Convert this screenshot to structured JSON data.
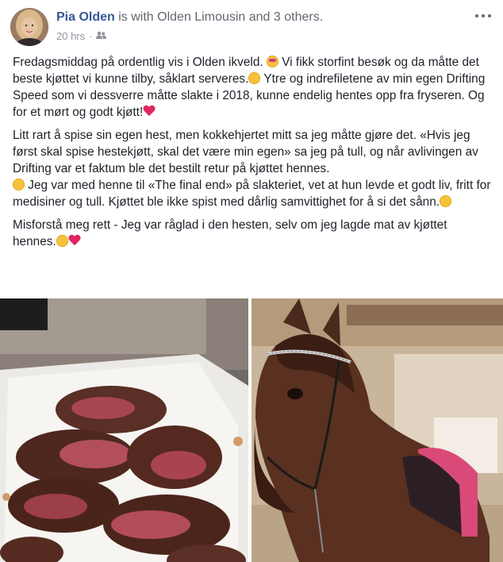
{
  "post": {
    "author": "Pia Olden",
    "with_text": " is with ",
    "tagged_page": "Olden Limousin",
    "and_text": " and ",
    "others": "3 others.",
    "time": "20 hrs",
    "separator": "·",
    "audience_icon": "friends-icon",
    "more_icon": "more-options-icon"
  },
  "body": {
    "p1a": "Fredagsmiddag på ordentlig vis i Olden ikveld.",
    "p1b": " Vi fikk storfint besøk og da måtte det beste kjøttet vi kunne tilby, såklart serveres.",
    "p1c": " Ytre og indrefiletene av min egen Drifting Speed som vi dessverre måtte slakte i 2018, kunne endelig hentes opp fra fryseren. Og for et mørt og godt kjøtt!",
    "p2a": "Litt rart å spise sin egen hest, men kokkehjertet mitt sa jeg måtte gjøre det. «Hvis jeg først skal spise hestekjøtt, skal det være min egen» sa jeg på tull, og når avlivingen av Drifting var et faktum ble det bestilt retur på kjøttet hennes.",
    "p2b": " Jeg var med henne til «The final end» på slakteriet, vet at hun levde et godt liv, fritt for medisiner og tull. Kjøttet ble ikke spist med dårlig samvittighet for å si det sånn.",
    "p3a": "Misforstå meg rett - Jeg var råglad i den hesten, selv om jeg lagde mat av kjøttet hennes."
  },
  "colors": {
    "author": "#385898",
    "meta": "#90949c",
    "text": "#1d2129",
    "heart": "#e0245e",
    "emoji": "#f7c23b"
  }
}
